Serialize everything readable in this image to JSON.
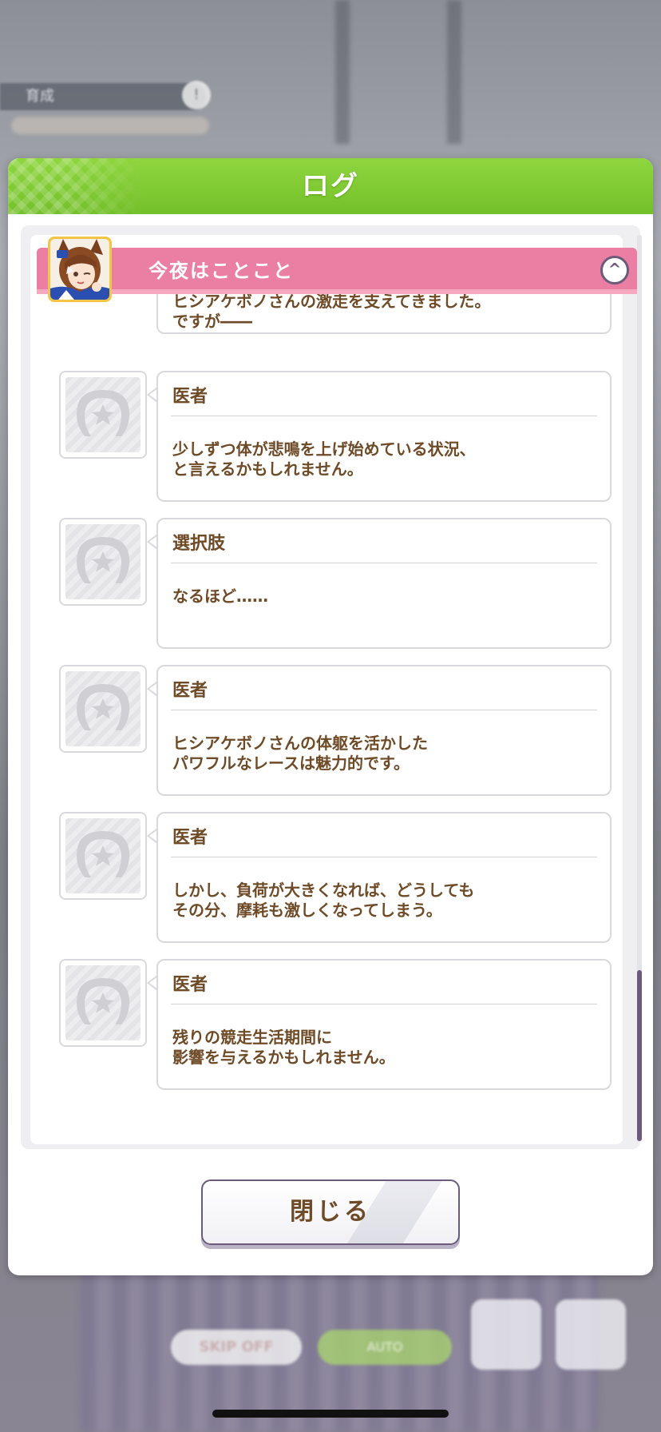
{
  "background": {
    "top_bar_label": "育成",
    "top_bar_badge": "!",
    "skip_label": "SKIP OFF",
    "auto_label": "AUTO"
  },
  "dialog": {
    "title": "ログ",
    "close_label": "閉じる"
  },
  "chapter": {
    "title": "今夜はことこと",
    "collapse_icon": "chevron-up-icon",
    "avatar": "character-portrait"
  },
  "entries": [
    {
      "speaker": "",
      "text": "今までは、生まれ持っての体の強さが\nヒシアケボノさんの激走を支えてきました。\nですが――"
    },
    {
      "speaker": "医者",
      "text": "少しずつ体が悲鳴を上げ始めている状況、\nと言えるかもしれません。"
    },
    {
      "speaker": "選択肢",
      "text": "なるほど……"
    },
    {
      "speaker": "医者",
      "text": "ヒシアケボノさんの体躯を活かした\nパワフルなレースは魅力的です。"
    },
    {
      "speaker": "医者",
      "text": "しかし、負荷が大きくなれば、どうしても\nその分、摩耗も激しくなってしまう。"
    },
    {
      "speaker": "医者",
      "text": "残りの競走生活期間に\n影響を与えるかもしれません。"
    }
  ],
  "colors": {
    "header_green": "#7cc52f",
    "chapter_pink": "#ea7fa3",
    "text_brown": "#6e4a26",
    "accent_purple": "#6b5a7a"
  }
}
